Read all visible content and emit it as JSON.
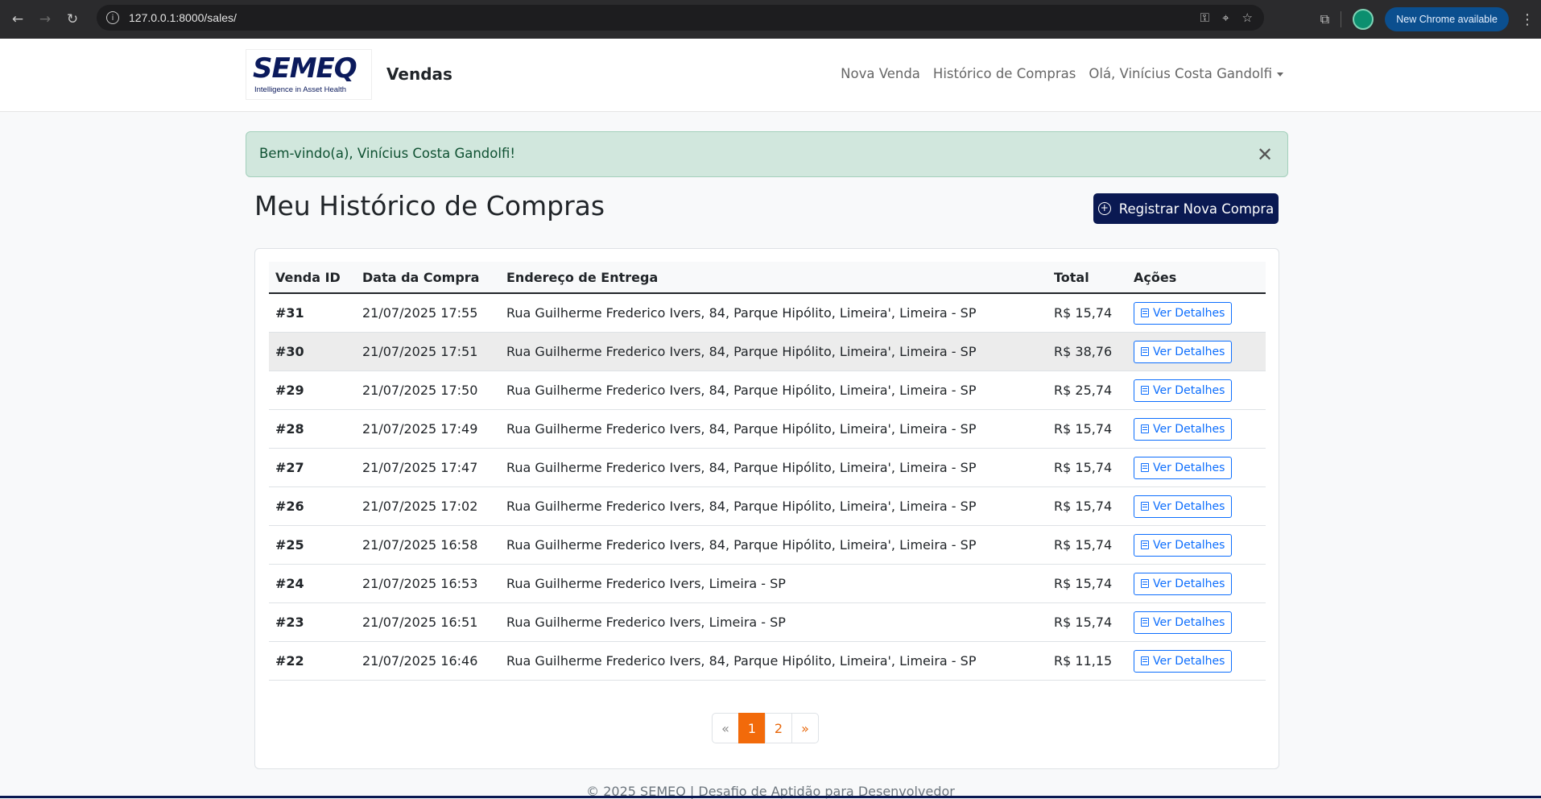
{
  "browser": {
    "url": "127.0.0.1:8000/sales/",
    "update_label": "New Chrome available"
  },
  "navbar": {
    "logo_mark": "SEMEQ",
    "logo_tagline": "Intelligence in Asset Health",
    "brand": "Vendas",
    "links": [
      "Nova Venda",
      "Histórico de Compras"
    ],
    "user_menu": "Olá, Vinícius Costa Gandolfi"
  },
  "alert": {
    "message": "Bem-vindo(a), Vinícius Costa Gandolfi!"
  },
  "page": {
    "title": "Meu Histórico de Compras",
    "new_purchase_button": "Registrar Nova Compra"
  },
  "table": {
    "headers": [
      "Venda ID",
      "Data da Compra",
      "Endereço de Entrega",
      "Total",
      "Ações"
    ],
    "action_label": "Ver Detalhes",
    "rows": [
      {
        "id": "#31",
        "date": "21/07/2025 17:55",
        "address": "Rua Guilherme Frederico Ivers, 84, Parque Hipólito, Limeira', Limeira - SP",
        "total": "R$ 15,74"
      },
      {
        "id": "#30",
        "date": "21/07/2025 17:51",
        "address": "Rua Guilherme Frederico Ivers, 84, Parque Hipólito, Limeira', Limeira - SP",
        "total": "R$ 38,76"
      },
      {
        "id": "#29",
        "date": "21/07/2025 17:50",
        "address": "Rua Guilherme Frederico Ivers, 84, Parque Hipólito, Limeira', Limeira - SP",
        "total": "R$ 25,74"
      },
      {
        "id": "#28",
        "date": "21/07/2025 17:49",
        "address": "Rua Guilherme Frederico Ivers, 84, Parque Hipólito, Limeira', Limeira - SP",
        "total": "R$ 15,74"
      },
      {
        "id": "#27",
        "date": "21/07/2025 17:47",
        "address": "Rua Guilherme Frederico Ivers, 84, Parque Hipólito, Limeira', Limeira - SP",
        "total": "R$ 15,74"
      },
      {
        "id": "#26",
        "date": "21/07/2025 17:02",
        "address": "Rua Guilherme Frederico Ivers, 84, Parque Hipólito, Limeira', Limeira - SP",
        "total": "R$ 15,74"
      },
      {
        "id": "#25",
        "date": "21/07/2025 16:58",
        "address": "Rua Guilherme Frederico Ivers, 84, Parque Hipólito, Limeira', Limeira - SP",
        "total": "R$ 15,74"
      },
      {
        "id": "#24",
        "date": "21/07/2025 16:53",
        "address": "Rua Guilherme Frederico Ivers, Limeira - SP",
        "total": "R$ 15,74"
      },
      {
        "id": "#23",
        "date": "21/07/2025 16:51",
        "address": "Rua Guilherme Frederico Ivers, Limeira - SP",
        "total": "R$ 15,74"
      },
      {
        "id": "#22",
        "date": "21/07/2025 16:46",
        "address": "Rua Guilherme Frederico Ivers, 84, Parque Hipólito, Limeira', Limeira - SP",
        "total": "R$ 11,15"
      }
    ]
  },
  "pagination": {
    "prev": "«",
    "pages": [
      "1",
      "2"
    ],
    "active": "1",
    "next": "»"
  },
  "footer": {
    "text": "© 2025 SEMEQ | Desafio de Aptidão para Desenvolvedor"
  }
}
